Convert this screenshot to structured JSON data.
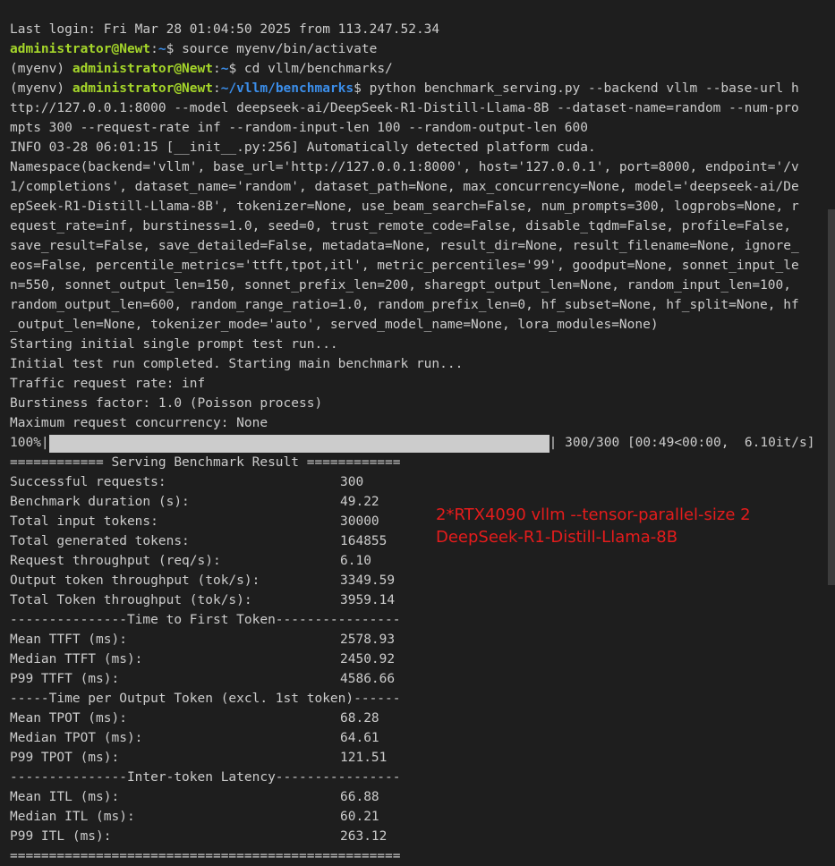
{
  "terminal": {
    "last_login": "Last login: Fri Mar 28 01:04:50 2025 from 113.247.52.34",
    "prompt1": {
      "user": "administrator@Newt",
      "sep": ":",
      "path": "~",
      "suffix": "$",
      "command": " source myenv/bin/activate"
    },
    "prompt2": {
      "env": "(myenv) ",
      "user": "administrator@Newt",
      "sep": ":",
      "path": "~",
      "suffix": "$",
      "command": " cd vllm/benchmarks/"
    },
    "prompt3": {
      "env": "(myenv) ",
      "user": "administrator@Newt",
      "sep": ":",
      "path": "~/vllm/benchmarks",
      "suffix": "$",
      "command": " python benchmark_serving.py --backend vllm --base-url h"
    },
    "command_cont": [
      "ttp://127.0.0.1:8000 --model deepseek-ai/DeepSeek-R1-Distill-Llama-8B --dataset-name=random --num-pro",
      "mpts 300 --request-rate inf --random-input-len 100 --random-output-len 600"
    ],
    "output": [
      "INFO 03-28 06:01:15 [__init__.py:256] Automatically detected platform cuda.",
      "Namespace(backend='vllm', base_url='http://127.0.0.1:8000', host='127.0.0.1', port=8000, endpoint='/v",
      "1/completions', dataset_name='random', dataset_path=None, max_concurrency=None, model='deepseek-ai/De",
      "epSeek-R1-Distill-Llama-8B', tokenizer=None, use_beam_search=False, num_prompts=300, logprobs=None, r",
      "equest_rate=inf, burstiness=1.0, seed=0, trust_remote_code=False, disable_tqdm=False, profile=False,",
      "save_result=False, save_detailed=False, metadata=None, result_dir=None, result_filename=None, ignore_",
      "eos=False, percentile_metrics='ttft,tpot,itl', metric_percentiles='99', goodput=None, sonnet_input_le",
      "n=550, sonnet_output_len=150, sonnet_prefix_len=200, sharegpt_output_len=None, random_input_len=100,",
      "random_output_len=600, random_range_ratio=1.0, random_prefix_len=0, hf_subset=None, hf_split=None, hf",
      "_output_len=None, tokenizer_mode='auto', served_model_name=None, lora_modules=None)",
      "Starting initial single prompt test run...",
      "Initial test run completed. Starting main benchmark run...",
      "Traffic request rate: inf",
      "Burstiness factor: 1.0 (Poisson process)",
      "Maximum request concurrency: None"
    ],
    "progress": {
      "percent_label": "100%|",
      "fraction": 1.0,
      "suffix": "| 300/300 [00:49<00:00,  6.10it/s]"
    },
    "result_header": "============ Serving Benchmark Result ============",
    "stats_main": [
      {
        "label": "Successful requests:",
        "value": "300"
      },
      {
        "label": "Benchmark duration (s):",
        "value": "49.22"
      },
      {
        "label": "Total input tokens:",
        "value": "30000"
      },
      {
        "label": "Total generated tokens:",
        "value": "164855"
      },
      {
        "label": "Request throughput (req/s):",
        "value": "6.10"
      },
      {
        "label": "Output token throughput (tok/s):",
        "value": "3349.59"
      },
      {
        "label": "Total Token throughput (tok/s):",
        "value": "3959.14"
      }
    ],
    "ttft_header": "---------------Time to First Token----------------",
    "stats_ttft": [
      {
        "label": "Mean TTFT (ms):",
        "value": "2578.93"
      },
      {
        "label": "Median TTFT (ms):",
        "value": "2450.92"
      },
      {
        "label": "P99 TTFT (ms):",
        "value": "4586.66"
      }
    ],
    "tpot_header": "-----Time per Output Token (excl. 1st token)------",
    "stats_tpot": [
      {
        "label": "Mean TPOT (ms):",
        "value": "68.28"
      },
      {
        "label": "Median TPOT (ms):",
        "value": "64.61"
      },
      {
        "label": "P99 TPOT (ms):",
        "value": "121.51"
      }
    ],
    "itl_header": "---------------Inter-token Latency----------------",
    "stats_itl": [
      {
        "label": "Mean ITL (ms):",
        "value": "66.88"
      },
      {
        "label": "Median ITL (ms):",
        "value": "60.21"
      },
      {
        "label": "P99 ITL (ms):",
        "value": "263.12"
      }
    ],
    "footer": "=================================================="
  },
  "annotation": {
    "line1": "2*RTX4090 vllm --tensor-parallel-size 2",
    "line2": "DeepSeek-R1-Distill-Llama-8B",
    "color": "#e51c1c"
  },
  "colors": {
    "background": "#1e1e1e",
    "text": "#cccccc",
    "user": "#a5d62a",
    "path": "#3b8eea"
  }
}
